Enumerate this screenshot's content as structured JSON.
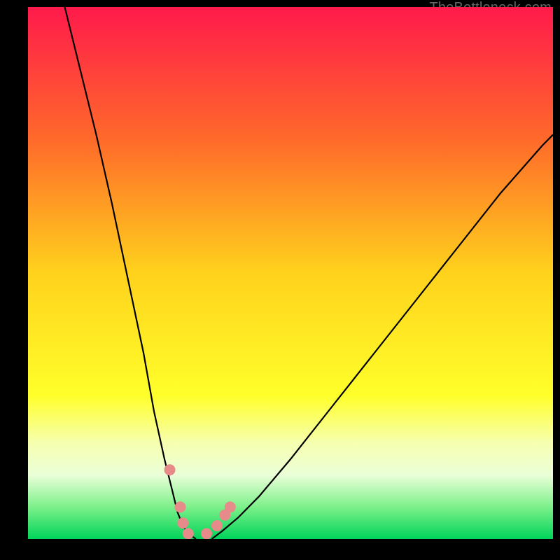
{
  "watermark": "TheBottleneck.com",
  "chart_data": {
    "type": "line",
    "title": "",
    "xlabel": "",
    "ylabel": "",
    "xlim": [
      0,
      100
    ],
    "ylim": [
      0,
      100
    ],
    "grid": false,
    "legend": false,
    "background_gradient": {
      "stops": [
        {
          "y_pct": 0,
          "color": "#ff1a4b"
        },
        {
          "y_pct": 25,
          "color": "#ff6a2a"
        },
        {
          "y_pct": 50,
          "color": "#ffd21c"
        },
        {
          "y_pct": 73,
          "color": "#ffff2a"
        },
        {
          "y_pct": 82,
          "color": "#f6ffb0"
        },
        {
          "y_pct": 88,
          "color": "#eaffd8"
        },
        {
          "y_pct": 94,
          "color": "#7cf08a"
        },
        {
          "y_pct": 100,
          "color": "#00d45a"
        }
      ]
    },
    "series": [
      {
        "name": "left-curve",
        "x": [
          7,
          10,
          13,
          16,
          19,
          22,
          24,
          26,
          27.5,
          28.5,
          29.5,
          30.5,
          32
        ],
        "y": [
          100,
          88,
          76,
          63,
          49,
          35,
          24,
          15,
          9,
          5,
          2.5,
          1,
          0
        ]
      },
      {
        "name": "right-curve",
        "x": [
          35,
          37,
          40,
          44,
          50,
          58,
          66,
          74,
          82,
          90,
          98,
          100
        ],
        "y": [
          0,
          1.5,
          4,
          8,
          15,
          25,
          35,
          45,
          55,
          65,
          74,
          76
        ]
      }
    ],
    "markers": [
      {
        "name": "dot-1",
        "x": 27.0,
        "y": 13.0
      },
      {
        "name": "dot-2",
        "x": 29.0,
        "y": 6.0
      },
      {
        "name": "dot-3",
        "x": 29.5,
        "y": 3.0
      },
      {
        "name": "dot-4",
        "x": 30.5,
        "y": 1.0
      },
      {
        "name": "dot-5",
        "x": 34.0,
        "y": 1.0
      },
      {
        "name": "dot-6",
        "x": 36.0,
        "y": 2.5
      },
      {
        "name": "dot-7",
        "x": 37.5,
        "y": 4.5
      },
      {
        "name": "dot-8",
        "x": 38.5,
        "y": 6.0
      }
    ],
    "marker_style": {
      "color": "#e68a8a",
      "radius_px": 8
    }
  }
}
